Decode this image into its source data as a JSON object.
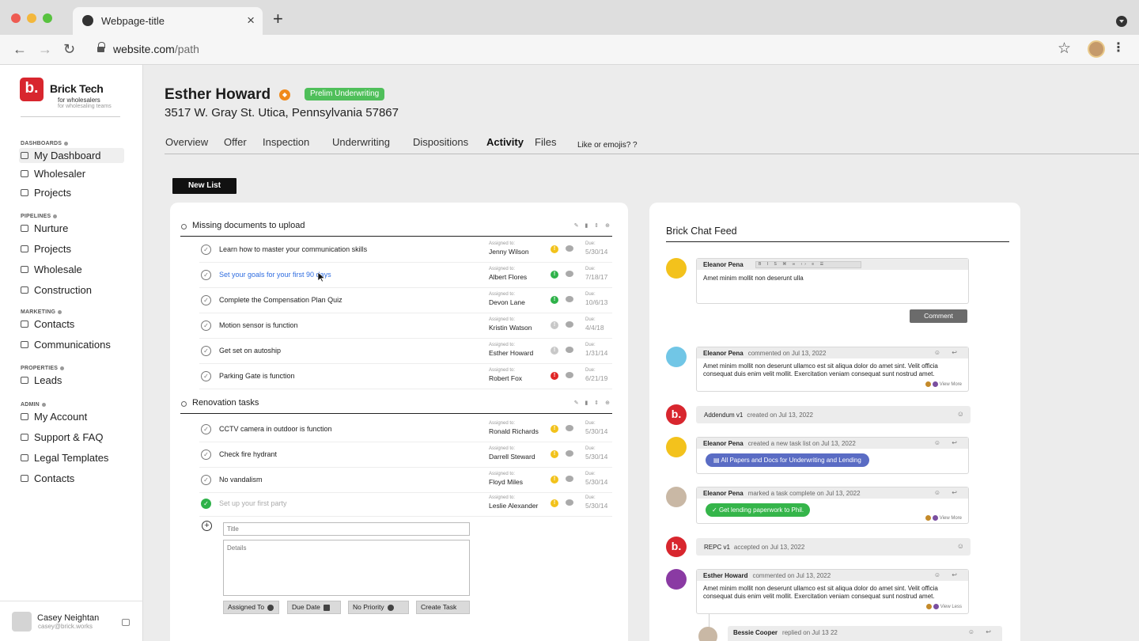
{
  "browser": {
    "tab_title": "Webpage-title",
    "url_host": "website.com",
    "url_path": "/path"
  },
  "sidebar": {
    "brand_initial": "b.",
    "brand_name": "Brick Tech",
    "brand_tagline": "for wholesalers",
    "brand_subtagline": "for wholesaling teams",
    "sections": {
      "dashboards": "DASHBOARDS",
      "pipelines": "PIPELINES",
      "marketing": "MARKETING",
      "properties": "PROPERTIES",
      "admin": "ADMIN"
    },
    "items": {
      "my_dashboard": "My Dashboard",
      "wholesaler": "Wholesaler",
      "projects_1": "Projects",
      "nurture": "Nurture",
      "projects_2": "Projects",
      "wholesale": "Wholesale",
      "construction": "Construction",
      "contacts_1": "Contacts",
      "communications": "Communications",
      "leads": "Leads",
      "my_account": "My Account",
      "support": "Support & FAQ",
      "legal": "Legal Templates",
      "contacts_2": "Contacts"
    },
    "user": {
      "name": "Casey Neightan",
      "email": "casey@brick.works"
    }
  },
  "header": {
    "name": "Esther Howard",
    "status": "Prelim Underwriting",
    "address": "3517 W. Gray St. Utica, Pennsylvania 57867",
    "tabs": [
      "Overview",
      "Offer",
      "Inspection",
      "Underwriting",
      "Dispositions",
      "Activity",
      "Files"
    ],
    "tab_hint": "Like or emojis? ?"
  },
  "tasks": {
    "new_list": "New List",
    "assigned_label": "Assigned to:",
    "due_label": "Due:",
    "groups": [
      {
        "title": "Missing documents to upload",
        "rows": [
          {
            "title": "Learn how to master your communication skills",
            "assignee": "Jenny Wilson",
            "due": "5/30/14"
          },
          {
            "title": "Set your goals for your first 90 days",
            "assignee": "Albert Flores",
            "due": "7/18/17"
          },
          {
            "title": "Complete the Compensation Plan Quiz",
            "assignee": "Devon Lane",
            "due": "10/6/13"
          },
          {
            "title": "Motion sensor is function",
            "assignee": "Kristin Watson",
            "due": "4/4/18"
          },
          {
            "title": "Get set on autoship",
            "assignee": "Esther Howard",
            "due": "1/31/14"
          },
          {
            "title": "Parking Gate is function",
            "assignee": "Robert Fox",
            "due": "6/21/19"
          }
        ]
      },
      {
        "title": "Renovation tasks",
        "rows": [
          {
            "title": "CCTV camera in outdoor is function",
            "assignee": "Ronald Richards",
            "due": "5/30/14"
          },
          {
            "title": "Check fire hydrant",
            "assignee": "Darrell Steward",
            "due": "5/30/14"
          },
          {
            "title": "No vandalism",
            "assignee": "Floyd Miles",
            "due": "5/30/14"
          },
          {
            "title": "Set up your first party",
            "assignee": "Leslie Alexander",
            "due": "5/30/14"
          }
        ]
      }
    ],
    "form": {
      "title_placeholder": "Title",
      "details_placeholder": "Details",
      "assigned_to": "Assigned To",
      "due_date": "Due Date",
      "priority": "No Priority",
      "create": "Create Task"
    },
    "priority_colors": {
      "yellow": "#f2c21b",
      "green": "#2fb24a",
      "gray": "#c8c8c8",
      "red": "#e02626"
    }
  },
  "chat": {
    "title": "Brick Chat Feed",
    "compose": {
      "author": "Eleanor Pena",
      "text": "Amet minim mollit non deserunt ulla",
      "button": "Comment"
    },
    "entries": {
      "c1_author": "Eleanor Pena",
      "c1_meta": "commented on Jul 13, 2022",
      "c1_text": "Amet minim mollit non deserunt ullamco est sit aliqua dolor do amet sint. Velit officia consequat duis enim velit mollit. Exercitation veniam consequat sunt nostrud amet.",
      "c1_more": "View More",
      "a1_name": "Addendum v1",
      "a1_meta": "created on Jul 13, 2022",
      "c2_author": "Eleanor Pena",
      "c2_meta": "created a new task list on Jul 13, 2022",
      "c2_pill": "All Papers and Docs for Underwriting and Lending",
      "c3_author": "Eleanor Pena",
      "c3_meta": "marked a task complete on Jul 13, 2022",
      "c3_pill": "Get lending paperwork to Phil.",
      "c3_more": "View More",
      "a2_name": "REPC v1",
      "a2_meta": "accepted on Jul 13, 2022",
      "c4_author": "Esther Howard",
      "c4_meta": "commented on Jul 13, 2022",
      "c4_text": "Amet minim mollit non deserunt ullamco est sit aliqua dolor do amet sint. Velit officia consequat duis enim velit mollit. Exercitation veniam consequat sunt nostrud amet.",
      "c4_more": "View Less",
      "r1_author": "Bessie Cooper",
      "r1_meta": "replied on Jul 13 22"
    }
  }
}
